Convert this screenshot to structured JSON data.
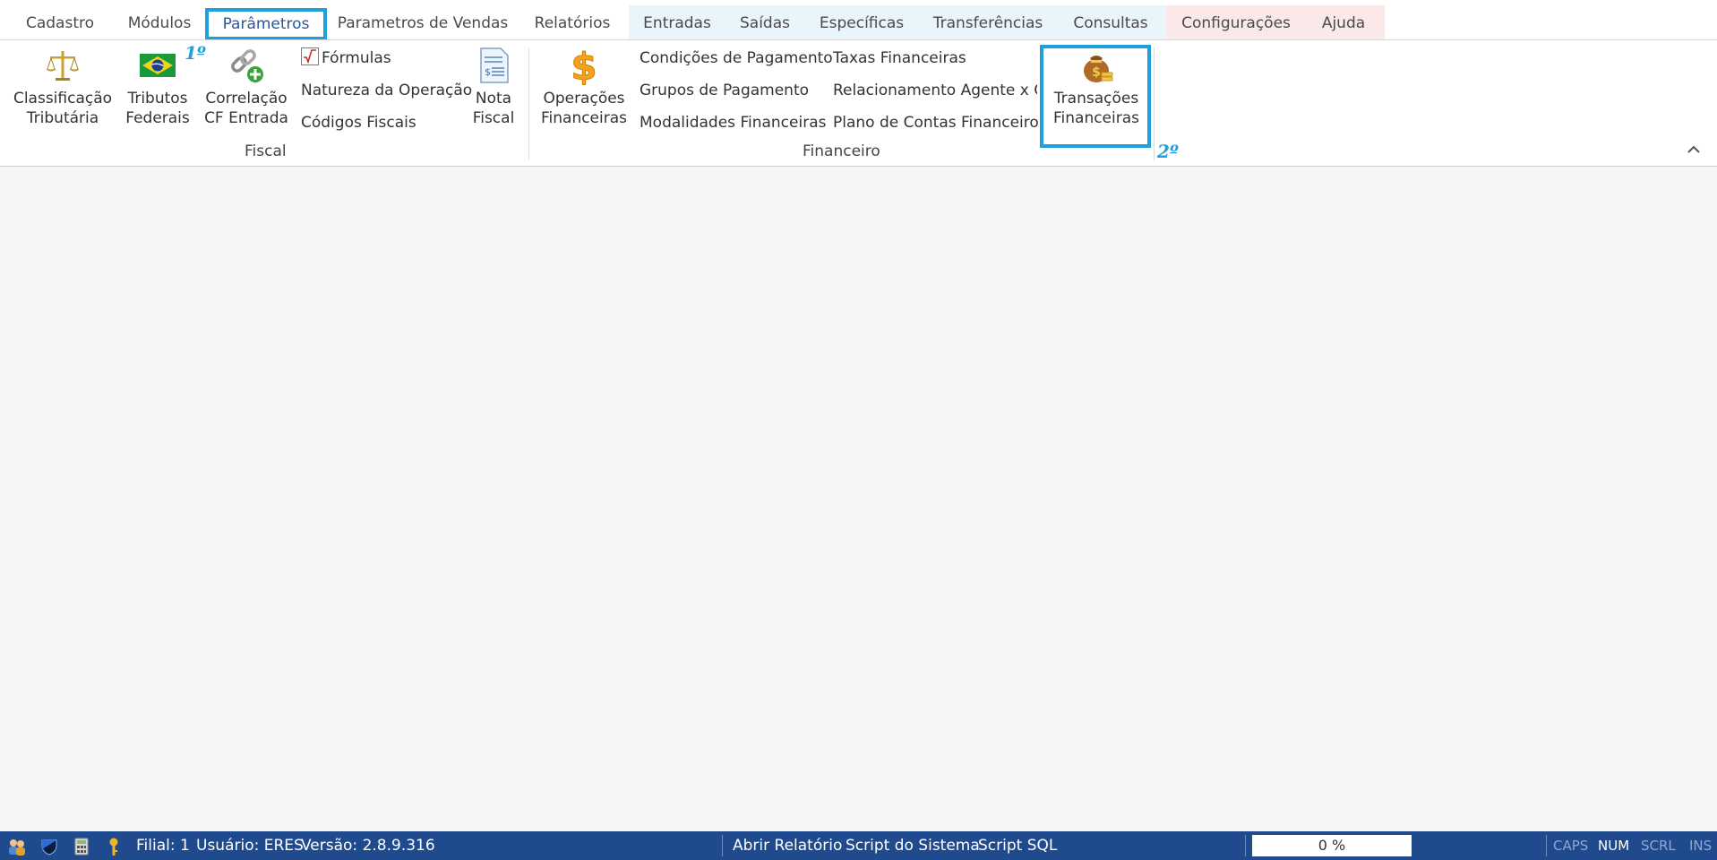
{
  "tabs": {
    "cadastro": "Cadastro",
    "modulos": "Módulos",
    "parametros": "Parâmetros",
    "parametros_vendas": "Parametros de Vendas",
    "relatorios": "Relatórios",
    "entradas": "Entradas",
    "saidas": "Saídas",
    "especificas": "Específicas",
    "transferencias": "Transferências",
    "consultas": "Consultas",
    "configuracoes": "Configurações",
    "ajuda": "Ajuda",
    "active": "Parâmetros"
  },
  "colors": {
    "group_blue_bg": "#e9f4fb",
    "group_red_bg": "#fbe9ea",
    "highlight": "#1ea0dc",
    "statusbar": "#1f4b8e"
  },
  "ribbon": {
    "fiscal": {
      "label": "Fiscal",
      "classificacao": {
        "line1": "Classificação",
        "line2": "Tributária",
        "icon": "scales-icon"
      },
      "tributos": {
        "line1": "Tributos",
        "line2": "Federais",
        "icon": "brazil-flag-icon"
      },
      "correlacao": {
        "line1": "Correlação",
        "line2": "CF Entrada",
        "icon": "chain-link-add-icon"
      },
      "formulas": {
        "label": "Fórmulas",
        "icon": "square-root-icon"
      },
      "natureza": {
        "label": "Natureza da Operação"
      },
      "codigos": {
        "label": "Códigos Fiscais"
      },
      "nota": {
        "line1": "Nota",
        "line2": "Fiscal",
        "icon": "invoice-document-icon"
      }
    },
    "financeiro": {
      "label": "Financeiro",
      "operacoes": {
        "line1": "Operações",
        "line2": "Financeiras",
        "icon": "dollar-sign-icon"
      },
      "condicoes": "Condições de Pagamento",
      "grupos": "Grupos de Pagamento",
      "modalidades": "Modalidades Financeiras",
      "taxas": "Taxas Financeiras",
      "relacionamento": "Relacionamento Agente x OP",
      "plano": "Plano de Contas Financeiro",
      "transacoes": {
        "line1": "Transações",
        "line2": "Financeiras",
        "icon": "money-bag-icon"
      }
    }
  },
  "annotations": {
    "step1": "1º",
    "step2": "2º"
  },
  "statusbar": {
    "filial": "Filial: 1",
    "usuario": "Usuário: ERES",
    "versao": "Versão: 2.8.9.316",
    "abrir_relatorio": "Abrir Relatório",
    "script_sistema": "Script do Sistema",
    "script_sql": "Script SQL",
    "progress": "0 %",
    "caps": "CAPS",
    "num": "NUM",
    "scrl": "SCRL",
    "ins": "INS"
  }
}
